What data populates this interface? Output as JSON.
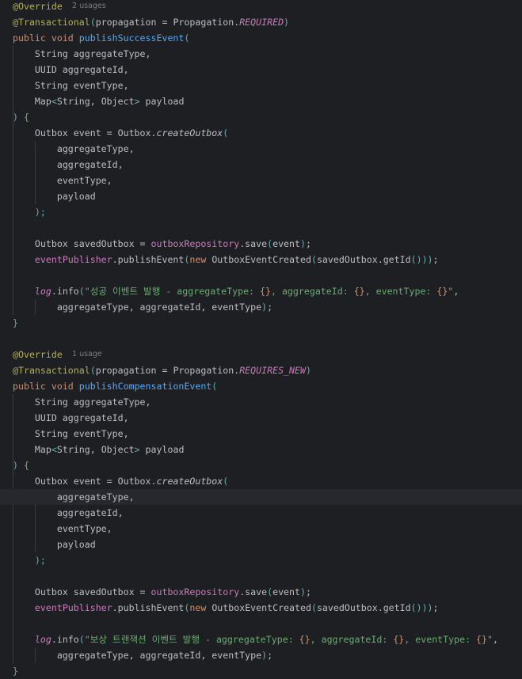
{
  "editor": {
    "language": "java",
    "theme_colors": {
      "background": "#1e1f22",
      "text": "#bcbec4",
      "keyword": "#cf8e6d",
      "annotation": "#b3ae60",
      "method_declaration": "#56a8f5",
      "static_field": "#c77dbb",
      "string": "#6aab73",
      "inlay_hint": "#7a7e85",
      "caret_line": "#26282e"
    },
    "caret_line": 31
  },
  "lines": [
    {
      "hint": "2 usages",
      "tokens": [
        {
          "t": "@Override",
          "c": "annotation"
        }
      ]
    },
    {
      "tokens": [
        {
          "t": "@Transactional",
          "c": "annotation"
        },
        {
          "t": "(",
          "c": "paren1"
        },
        {
          "t": "propagation = Propagation.",
          "c": "plain"
        },
        {
          "t": "REQUIRED",
          "c": "static"
        },
        {
          "t": ")",
          "c": "paren1"
        }
      ]
    },
    {
      "tokens": [
        {
          "t": "public void ",
          "c": "keyword"
        },
        {
          "t": "publishSuccessEvent",
          "c": "method"
        },
        {
          "t": "(",
          "c": "paren1"
        }
      ]
    },
    {
      "tokens": [
        {
          "t": "    String aggregateType,",
          "c": "plain"
        }
      ]
    },
    {
      "tokens": [
        {
          "t": "    UUID aggregateId,",
          "c": "plain"
        }
      ]
    },
    {
      "tokens": [
        {
          "t": "    String eventType,",
          "c": "plain"
        }
      ]
    },
    {
      "tokens": [
        {
          "t": "    Map",
          "c": "plain"
        },
        {
          "t": "<",
          "c": "paren1"
        },
        {
          "t": "String, Object",
          "c": "plain"
        },
        {
          "t": ">",
          "c": "paren1"
        },
        {
          "t": " payload",
          "c": "plain"
        }
      ]
    },
    {
      "tokens": [
        {
          "t": ") ",
          "c": "paren1"
        },
        {
          "t": "{",
          "c": "brace"
        }
      ]
    },
    {
      "tokens": [
        {
          "t": "    Outbox event = Outbox.",
          "c": "plain"
        },
        {
          "t": "createOutbox",
          "c": "staticcall"
        },
        {
          "t": "(",
          "c": "paren1"
        }
      ]
    },
    {
      "tokens": [
        {
          "t": "        aggregateType,",
          "c": "plain"
        }
      ]
    },
    {
      "tokens": [
        {
          "t": "        aggregateId,",
          "c": "plain"
        }
      ]
    },
    {
      "tokens": [
        {
          "t": "        eventType,",
          "c": "plain"
        }
      ]
    },
    {
      "tokens": [
        {
          "t": "        payload",
          "c": "plain"
        }
      ]
    },
    {
      "tokens": [
        {
          "t": "    );",
          "c": "paren1"
        }
      ]
    },
    {
      "tokens": []
    },
    {
      "tokens": [
        {
          "t": "    Outbox savedOutbox = ",
          "c": "plain"
        },
        {
          "t": "outboxRepository",
          "c": "field"
        },
        {
          "t": ".save",
          "c": "plain"
        },
        {
          "t": "(",
          "c": "paren1"
        },
        {
          "t": "event",
          "c": "plain"
        },
        {
          "t": ")",
          "c": "paren1"
        },
        {
          "t": ";",
          "c": "plain"
        }
      ]
    },
    {
      "tokens": [
        {
          "t": "    ",
          "c": "plain"
        },
        {
          "t": "eventPublisher",
          "c": "field"
        },
        {
          "t": ".publishEvent",
          "c": "plain"
        },
        {
          "t": "(",
          "c": "paren1"
        },
        {
          "t": "new ",
          "c": "keyword"
        },
        {
          "t": "OutboxEventCreated",
          "c": "plain"
        },
        {
          "t": "(",
          "c": "paren1"
        },
        {
          "t": "savedOutbox.getId",
          "c": "plain"
        },
        {
          "t": "()))",
          "c": "paren1"
        },
        {
          "t": ";",
          "c": "plain"
        }
      ]
    },
    {
      "tokens": []
    },
    {
      "tokens": [
        {
          "t": "    ",
          "c": "plain"
        },
        {
          "t": "log",
          "c": "log"
        },
        {
          "t": ".info",
          "c": "plain"
        },
        {
          "t": "(",
          "c": "paren1"
        },
        {
          "t": "\"성공 이벤트 발행 - aggregateType: ",
          "c": "string"
        },
        {
          "t": "{}",
          "c": "keyword"
        },
        {
          "t": ", aggregateId: ",
          "c": "string"
        },
        {
          "t": "{}",
          "c": "keyword"
        },
        {
          "t": ", eventType: ",
          "c": "string"
        },
        {
          "t": "{}",
          "c": "keyword"
        },
        {
          "t": "\"",
          "c": "string"
        },
        {
          "t": ",",
          "c": "plain"
        }
      ]
    },
    {
      "tokens": [
        {
          "t": "        aggregateType, aggregateId, eventType",
          "c": "plain"
        },
        {
          "t": ")",
          "c": "paren1"
        },
        {
          "t": ";",
          "c": "plain"
        }
      ]
    },
    {
      "tokens": [
        {
          "t": "}",
          "c": "brace"
        }
      ]
    },
    {
      "tokens": []
    },
    {
      "hint": "1 usage",
      "tokens": [
        {
          "t": "@Override",
          "c": "annotation"
        }
      ]
    },
    {
      "tokens": [
        {
          "t": "@Transactional",
          "c": "annotation"
        },
        {
          "t": "(",
          "c": "paren1"
        },
        {
          "t": "propagation = Propagation.",
          "c": "plain"
        },
        {
          "t": "REQUIRES_NEW",
          "c": "static"
        },
        {
          "t": ")",
          "c": "paren1"
        }
      ]
    },
    {
      "tokens": [
        {
          "t": "public void ",
          "c": "keyword"
        },
        {
          "t": "publishCompensationEvent",
          "c": "method"
        },
        {
          "t": "(",
          "c": "paren1"
        }
      ]
    },
    {
      "tokens": [
        {
          "t": "    String aggregateType,",
          "c": "plain"
        }
      ]
    },
    {
      "tokens": [
        {
          "t": "    UUID aggregateId,",
          "c": "plain"
        }
      ]
    },
    {
      "tokens": [
        {
          "t": "    String eventType,",
          "c": "plain"
        }
      ]
    },
    {
      "tokens": [
        {
          "t": "    Map",
          "c": "plain"
        },
        {
          "t": "<",
          "c": "paren1"
        },
        {
          "t": "String, Object",
          "c": "plain"
        },
        {
          "t": ">",
          "c": "paren1"
        },
        {
          "t": " payload",
          "c": "plain"
        }
      ]
    },
    {
      "tokens": [
        {
          "t": ") ",
          "c": "paren1"
        },
        {
          "t": "{",
          "c": "brace"
        }
      ]
    },
    {
      "tokens": [
        {
          "t": "    Outbox event = Outbox.",
          "c": "plain"
        },
        {
          "t": "createOutbox",
          "c": "staticcall"
        },
        {
          "t": "(",
          "c": "paren1"
        }
      ]
    },
    {
      "tokens": [
        {
          "t": "        aggregateType,",
          "c": "plain"
        }
      ]
    },
    {
      "tokens": [
        {
          "t": "        aggregateId,",
          "c": "plain"
        }
      ]
    },
    {
      "tokens": [
        {
          "t": "        eventType,",
          "c": "plain"
        }
      ]
    },
    {
      "tokens": [
        {
          "t": "        payload",
          "c": "plain"
        }
      ]
    },
    {
      "tokens": [
        {
          "t": "    );",
          "c": "paren1"
        }
      ]
    },
    {
      "tokens": []
    },
    {
      "tokens": [
        {
          "t": "    Outbox savedOutbox = ",
          "c": "plain"
        },
        {
          "t": "outboxRepository",
          "c": "field"
        },
        {
          "t": ".save",
          "c": "plain"
        },
        {
          "t": "(",
          "c": "paren1"
        },
        {
          "t": "event",
          "c": "plain"
        },
        {
          "t": ")",
          "c": "paren1"
        },
        {
          "t": ";",
          "c": "plain"
        }
      ]
    },
    {
      "tokens": [
        {
          "t": "    ",
          "c": "plain"
        },
        {
          "t": "eventPublisher",
          "c": "field"
        },
        {
          "t": ".publishEvent",
          "c": "plain"
        },
        {
          "t": "(",
          "c": "paren1"
        },
        {
          "t": "new ",
          "c": "keyword"
        },
        {
          "t": "OutboxEventCreated",
          "c": "plain"
        },
        {
          "t": "(",
          "c": "paren1"
        },
        {
          "t": "savedOutbox.getId",
          "c": "plain"
        },
        {
          "t": "()))",
          "c": "paren1"
        },
        {
          "t": ";",
          "c": "plain"
        }
      ]
    },
    {
      "tokens": []
    },
    {
      "tokens": [
        {
          "t": "    ",
          "c": "plain"
        },
        {
          "t": "log",
          "c": "log"
        },
        {
          "t": ".info",
          "c": "plain"
        },
        {
          "t": "(",
          "c": "paren1"
        },
        {
          "t": "\"보상 트랜잭션 이벤트 발행 - aggregateType: ",
          "c": "string"
        },
        {
          "t": "{}",
          "c": "keyword"
        },
        {
          "t": ", aggregateId: ",
          "c": "string"
        },
        {
          "t": "{}",
          "c": "keyword"
        },
        {
          "t": ", eventType: ",
          "c": "string"
        },
        {
          "t": "{}",
          "c": "keyword"
        },
        {
          "t": "\"",
          "c": "string"
        },
        {
          "t": ",",
          "c": "plain"
        }
      ]
    },
    {
      "tokens": [
        {
          "t": "        aggregateType, aggregateId, eventType",
          "c": "plain"
        },
        {
          "t": ")",
          "c": "paren1"
        },
        {
          "t": ";",
          "c": "plain"
        }
      ]
    },
    {
      "tokens": [
        {
          "t": "}",
          "c": "brace"
        }
      ]
    }
  ]
}
